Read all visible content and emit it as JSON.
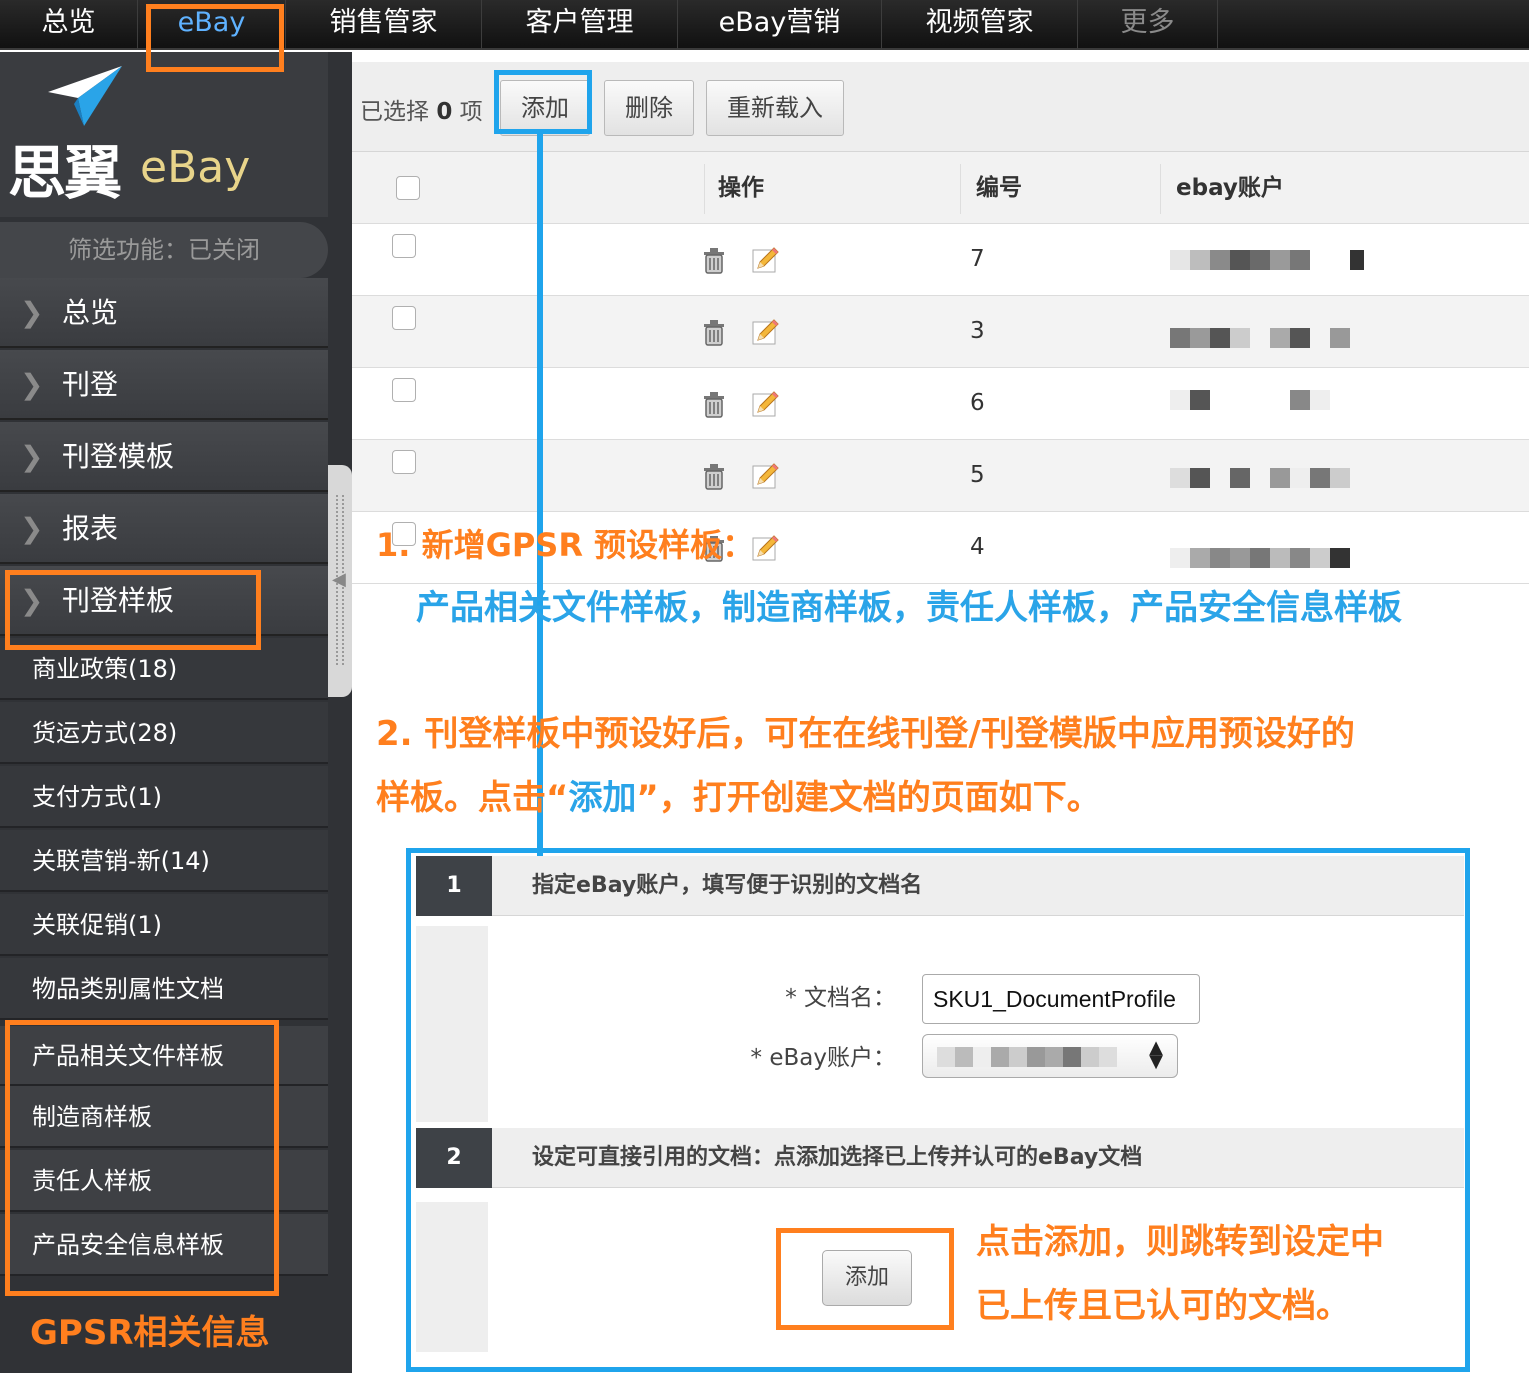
{
  "topnav": {
    "items": [
      "总览",
      "eBay",
      "销售管家",
      "客户管理",
      "eBay营销",
      "视频管家",
      "更多"
    ]
  },
  "sidebar": {
    "logo_cn": "思翼",
    "logo_en": "eBay",
    "filter_label": "筛选功能：已关闭",
    "menu": [
      "总览",
      "刊登",
      "刊登模板",
      "报表",
      "刊登样板"
    ],
    "submenu": [
      "商业政策(18)",
      "货运方式(28)",
      "支付方式(1)",
      "关联营销-新(14)",
      "关联促销(1)",
      "物品类别属性文档"
    ],
    "gpsr_items": [
      "产品相关文件样板",
      "制造商样板",
      "责任人样板",
      "产品安全信息样板"
    ],
    "gpsr_caption": "GPSR相关信息"
  },
  "toolbar": {
    "selected_prefix": "已选择",
    "selected_count": "0",
    "selected_suffix": "项",
    "add_label": "添加",
    "delete_label": "删除",
    "reload_label": "重新载入"
  },
  "table": {
    "headers": [
      "操作",
      "编号",
      "ebay账户"
    ],
    "rows": [
      {
        "id": "7"
      },
      {
        "id": "3"
      },
      {
        "id": "6"
      },
      {
        "id": "5"
      },
      {
        "id": "4"
      }
    ]
  },
  "annotations": {
    "step1_title": "1. 新增GPSR 预设样板：",
    "step1_detail": "产品相关文件样板，制造商样板，责任人样板，产品安全信息样板",
    "step2_line1": "2. 刊登样板中预设好后，可在在线刊登/刊登模版中应用预设好的",
    "step2_line2_a": "样板。点击“",
    "step2_line2_b": "添加",
    "step2_line2_c": "”，打开创建文档的页面如下。",
    "add_note_line1": "点击添加，则跳转到设定中",
    "add_note_line2": "已上传且已认可的文档。"
  },
  "form": {
    "step1_num": "1",
    "step1_title": "指定eBay账户，填写便于识别的文档名",
    "doc_name_label": "* 文档名：",
    "doc_name_value": "SKU1_DocumentProfile",
    "account_label": "* eBay账户：",
    "step2_num": "2",
    "step2_title": "设定可直接引用的文档：点添加选择已上传并认可的eBay文档",
    "add_label": "添加"
  },
  "colors": {
    "annotation_orange": "#ff7f1e",
    "annotation_blue": "#1fa4ec",
    "nav_active": "#5fb2ff"
  }
}
